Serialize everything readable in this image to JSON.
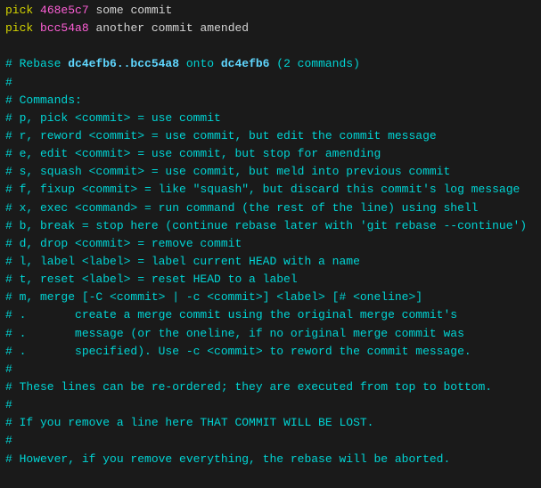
{
  "commits": [
    {
      "action": "pick",
      "hash": "468e5c7",
      "message": [
        "some",
        "commit"
      ]
    },
    {
      "action": "pick",
      "hash": "bcc54a8",
      "message": [
        "another",
        "commit",
        "amended"
      ]
    }
  ],
  "rebase_header": {
    "prefix": "# Rebase ",
    "range": "dc4efb6..bcc54a8",
    "onto_text": " onto ",
    "onto_hash": "dc4efb6",
    "suffix": " (2 commands)"
  },
  "comment_lines": [
    "#",
    "# Commands:",
    "# p, pick <commit> = use commit",
    "# r, reword <commit> = use commit, but edit the commit message",
    "# e, edit <commit> = use commit, but stop for amending",
    "# s, squash <commit> = use commit, but meld into previous commit",
    "# f, fixup <commit> = like \"squash\", but discard this commit's log message",
    "# x, exec <command> = run command (the rest of the line) using shell",
    "# b, break = stop here (continue rebase later with 'git rebase --continue')",
    "# d, drop <commit> = remove commit",
    "# l, label <label> = label current HEAD with a name",
    "# t, reset <label> = reset HEAD to a label",
    "# m, merge [-C <commit> | -c <commit>] <label> [# <oneline>]",
    "# .       create a merge commit using the original merge commit's",
    "# .       message (or the oneline, if no original merge commit was",
    "# .       specified). Use -c <commit> to reword the commit message.",
    "#",
    "# These lines can be re-ordered; they are executed from top to bottom.",
    "#",
    "# If you remove a line here THAT COMMIT WILL BE LOST.",
    "#",
    "# However, if you remove everything, the rebase will be aborted."
  ]
}
